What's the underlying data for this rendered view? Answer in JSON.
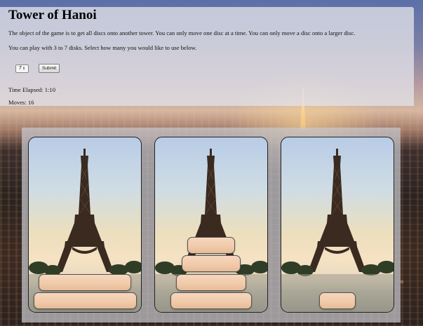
{
  "page": {
    "title": "Tower of Hanoi",
    "description": "The object of the game is to get all discs onto another tower. You can only move one disc at a time. You can only move a disc onto a larger disc.",
    "instructions": "You can play with 3 to 7 disks. Select how many you would like to use below.",
    "disc_select_value": "7",
    "submit_label": "Submit",
    "time_elapsed": "Time Elapsed: 1:10",
    "moves": "Moves: 16"
  },
  "game": {
    "total_discs": 7,
    "towers": [
      {
        "name": "tower-1",
        "discs": [
          7,
          6
        ]
      },
      {
        "name": "tower-2",
        "discs": [
          5,
          4,
          3,
          2
        ]
      },
      {
        "name": "tower-3",
        "discs": [
          1
        ]
      }
    ]
  },
  "colors": {
    "disc_fill": "#f0c9a9",
    "disc_border": "#555555",
    "panel_bg": "#e1e1e8",
    "board_bg": "#c8c8cd"
  }
}
